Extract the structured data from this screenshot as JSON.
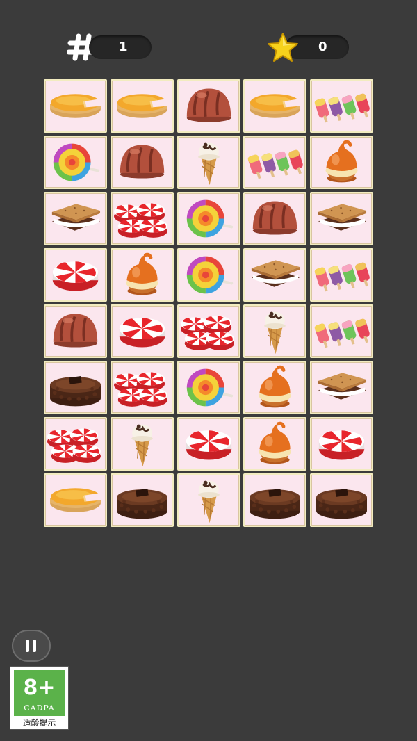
{
  "hud": {
    "moves_value": "1",
    "stars_value": "0",
    "moves_icon": "hash-icon",
    "stars_icon": "star-icon"
  },
  "board": {
    "rows": 8,
    "cols": 5,
    "tiles": [
      [
        "cheese-pie",
        "cheese-pie",
        "chocolate-dome",
        "cheese-pie",
        "popsicles"
      ],
      [
        "lollipop",
        "chocolate-dome",
        "ice-cream-cone",
        "popsicles",
        "caramel-cupcake"
      ],
      [
        "smores",
        "peppermint-candies",
        "lollipop",
        "chocolate-dome",
        "smores"
      ],
      [
        "peppermint-candy",
        "caramel-cupcake",
        "lollipop",
        "smores",
        "popsicles"
      ],
      [
        "chocolate-dome",
        "peppermint-candy",
        "peppermint-candies",
        "ice-cream-cone",
        "popsicles"
      ],
      [
        "chocolate-cake",
        "peppermint-candies",
        "lollipop",
        "caramel-cupcake",
        "smores"
      ],
      [
        "peppermint-candies",
        "ice-cream-cone",
        "peppermint-candy",
        "caramel-cupcake",
        "peppermint-candy"
      ],
      [
        "cheese-pie",
        "chocolate-cake",
        "ice-cream-cone",
        "chocolate-cake",
        "chocolate-cake"
      ]
    ]
  },
  "controls": {
    "pause_icon": "pause-icon"
  },
  "age_rating": {
    "rating": "8+",
    "org": "CADPA",
    "note": "适龄提示"
  }
}
